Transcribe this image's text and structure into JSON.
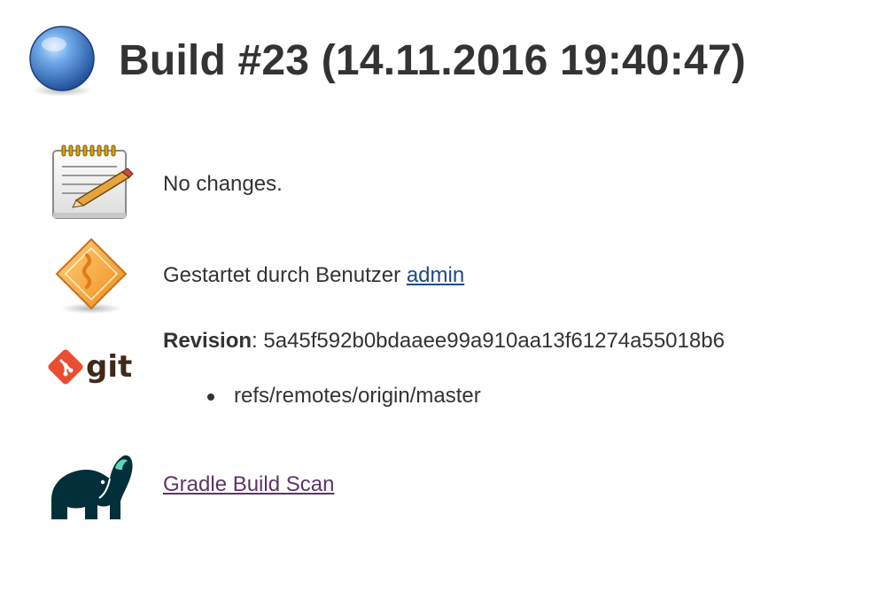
{
  "build": {
    "title": "Build #23 (14.11.2016 19:40:47)",
    "status_icon": "blue-ball-icon"
  },
  "changes": {
    "icon": "notepad-pencil-icon",
    "text": "No changes."
  },
  "cause": {
    "icon": "user-cause-icon",
    "prefix": "Gestartet durch Benutzer",
    "user_link": "admin"
  },
  "git": {
    "icon": "git-logo-icon",
    "logo_text": "git",
    "revision_label": "Revision",
    "revision_sep": ": ",
    "revision_hash": "5a45f592b0bdaaee99a910aa13f61274a55018b6",
    "branches": [
      "refs/remotes/origin/master"
    ]
  },
  "gradle": {
    "icon": "gradle-elephant-icon",
    "link": "Gradle Build Scan"
  },
  "colors": {
    "text": "#333333",
    "user_link": "#204a87",
    "visited_link": "#5c3566",
    "git_red": "#e94e31",
    "gradle_dark": "#02303a"
  }
}
